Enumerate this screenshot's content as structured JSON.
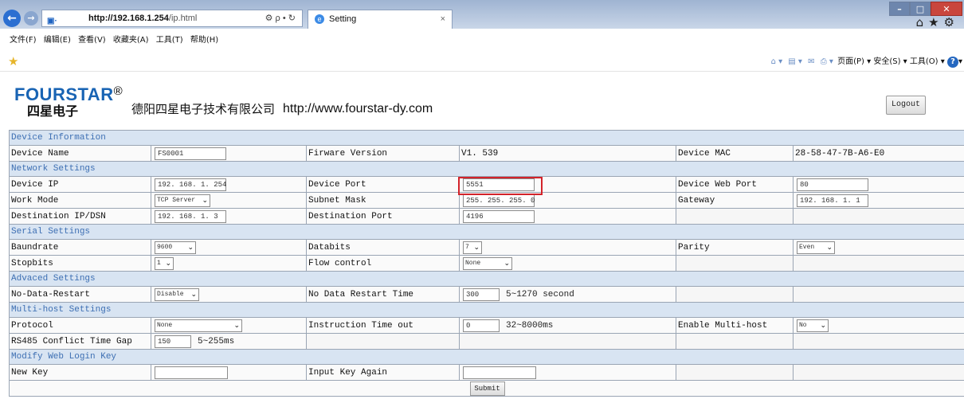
{
  "browser": {
    "url_host": "http://192.168.1.254",
    "url_path": "/ip.html",
    "addr_tools": "⚙ ρ • ↻",
    "tab_title": "Setting",
    "tab_close": "×",
    "menu": [
      "文件(F)",
      "编辑(E)",
      "查看(V)",
      "收藏夹(A)",
      "工具(T)",
      "帮助(H)"
    ],
    "cmd": {
      "page": "页面(P)",
      "safety": "安全(S)",
      "tools": "工具(O)"
    }
  },
  "header": {
    "logo_word": "FOURSTAR",
    "logo_reg": "®",
    "logo_cn": "四星电子",
    "company": "德阳四星电子技术有限公司",
    "website": "http://www.fourstar-dy.com",
    "logout": "Logout"
  },
  "sections": {
    "device_info": "Device Information",
    "network": "Network Settings",
    "serial": "Serial Settings",
    "advanced": "Advaced Settings",
    "multihost": "Multi-host Settings",
    "login_key": "Modify Web Login Key"
  },
  "device_info": {
    "name_label": "Device Name",
    "name_value": "FS0001",
    "fw_label": "Firware Version",
    "fw_value": "V1. 539",
    "mac_label": "Device MAC",
    "mac_value": "28-58-47-7B-A6-E0"
  },
  "network": {
    "ip_label": "Device IP",
    "ip_value": "192. 168. 1. 254",
    "port_label": "Device Port",
    "port_value": "5551",
    "webport_label": "Device Web Port",
    "webport_value": "80",
    "mode_label": "Work Mode",
    "mode_value": "TCP Server",
    "mask_label": "Subnet Mask",
    "mask_value": "255. 255. 255. 0",
    "gw_label": "Gateway",
    "gw_value": "192. 168. 1. 1",
    "dest_ip_label": "Destination IP/DSN",
    "dest_ip_value": "192. 168. 1. 3",
    "dest_port_label": "Destination Port",
    "dest_port_value": "4196"
  },
  "serial": {
    "baud_label": "Baundrate",
    "baud_value": "9600",
    "databits_label": "Databits",
    "databits_value": "7",
    "parity_label": "Parity",
    "parity_value": "Even",
    "stopbits_label": "Stopbits",
    "stopbits_value": "1",
    "flow_label": "Flow control",
    "flow_value": "None"
  },
  "advanced": {
    "restart_label": "No-Data-Restart",
    "restart_value": "Disable",
    "restart_time_label": "No Data Restart Time",
    "restart_time_value": "300",
    "restart_time_hint": "5~1270 second"
  },
  "multihost": {
    "protocol_label": "Protocol",
    "protocol_value": "None",
    "timeout_label": "Instruction Time out",
    "timeout_value": "0",
    "timeout_hint": "32~8000ms",
    "enable_label": "Enable Multi-host",
    "enable_value": "No",
    "gap_label": "RS485 Conflict Time Gap",
    "gap_value": "150",
    "gap_hint": "5~255ms"
  },
  "login_key": {
    "new_label": "New Key",
    "new_value": "",
    "again_label": "Input Key Again",
    "again_value": "",
    "submit": "Submit"
  }
}
